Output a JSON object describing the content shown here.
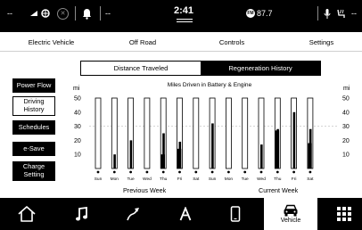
{
  "status_bar": {
    "left_dashes": "--",
    "signal_text": "--",
    "clock": "2:41",
    "radio_badge": "FM",
    "radio_freq": "87.7",
    "right_dashes": "--"
  },
  "top_tabs": [
    {
      "label": "Electric Vehicle"
    },
    {
      "label": "Off Road"
    },
    {
      "label": "Controls"
    },
    {
      "label": "Settings"
    }
  ],
  "sub_tabs": [
    {
      "label": "Distance Traveled",
      "active": false
    },
    {
      "label": "Regeneration History",
      "active": true
    }
  ],
  "side_menu": [
    {
      "label": "Power Flow",
      "selected": false
    },
    {
      "label": "Driving History",
      "selected": true
    },
    {
      "label": "Schedules",
      "selected": false
    },
    {
      "label": "e-Save",
      "selected": false
    },
    {
      "label": "Charge Setting",
      "selected": false
    }
  ],
  "chart_data": {
    "type": "bar",
    "title": "Miles Driven in Battery & Engine",
    "ylabel_left": "mi",
    "ylabel_right": "mi",
    "ylim": [
      0,
      50
    ],
    "yticks": [
      10,
      20,
      30,
      40,
      50
    ],
    "week_labels": [
      "Previous Week",
      "Current Week"
    ],
    "categories": [
      "Sun",
      "Mon",
      "Tue",
      "Wed",
      "Thu",
      "Fri",
      "Sat",
      "Sun",
      "Mon",
      "Tue",
      "Wed",
      "Thu",
      "Fri",
      "Sat"
    ],
    "series": [
      {
        "values": [
          0,
          10,
          20,
          0,
          25,
          19,
          0,
          32,
          0,
          0,
          17,
          28,
          40,
          28
        ]
      },
      {
        "values": [
          0,
          0,
          0,
          0,
          10,
          14,
          0,
          0,
          0,
          0,
          0,
          27,
          0,
          18
        ]
      }
    ],
    "grid": true
  },
  "bottom_nav": [
    {
      "icon": "home-icon",
      "label": ""
    },
    {
      "icon": "music-icon",
      "label": ""
    },
    {
      "icon": "navigation-icon",
      "label": ""
    },
    {
      "icon": "apps-icon",
      "label": ""
    },
    {
      "icon": "phone-icon",
      "label": ""
    },
    {
      "icon": "vehicle-icon",
      "label": "Vehicle",
      "active": true
    },
    {
      "icon": "grid-menu-icon",
      "label": ""
    }
  ]
}
